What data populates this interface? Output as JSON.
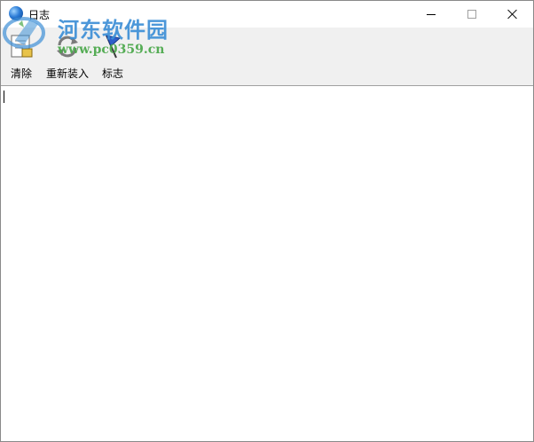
{
  "window": {
    "title": "日志",
    "icon": "globe-icon"
  },
  "titlebar_buttons": {
    "minimize_icon": "minimize-icon",
    "maximize_icon": "maximize-icon",
    "close_icon": "close-icon"
  },
  "toolbar": {
    "clear_label": "清除",
    "clear_icon": "clear-log-icon",
    "reload_label": "重新装入",
    "reload_icon": "reload-icon",
    "flag_label": "标志",
    "flag_icon": "flag-icon"
  },
  "watermark": {
    "name": "河东软件园",
    "url": "www.pc0359.cn"
  },
  "editor": {
    "content": ""
  },
  "colors": {
    "toolbar_bg": "#f0f0f0",
    "watermark_blue": "#3d8fd6",
    "watermark_green": "#4aa84a"
  }
}
